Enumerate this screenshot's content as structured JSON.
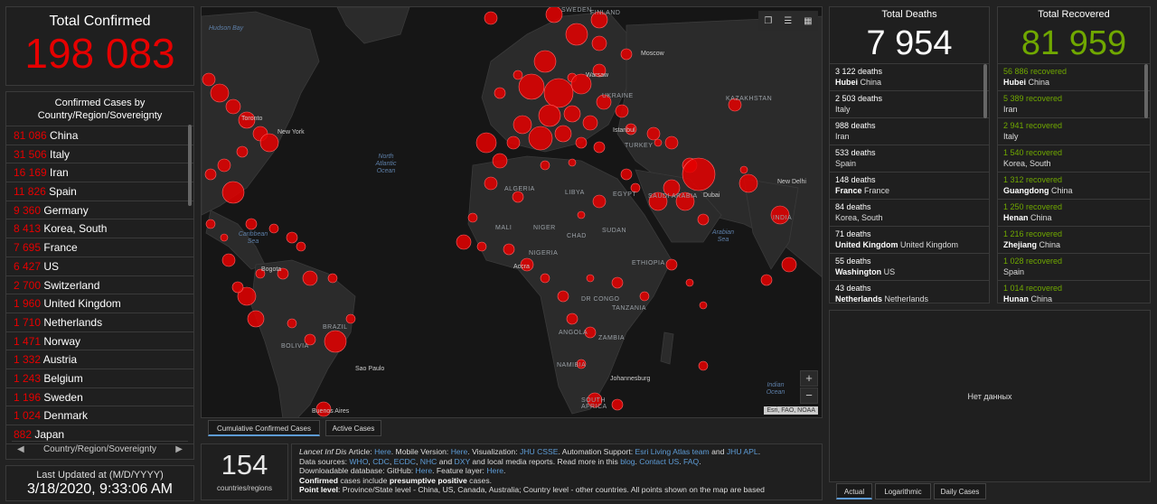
{
  "total_confirmed": {
    "title": "Total Confirmed",
    "value": "198 083"
  },
  "country_list": {
    "title": "Confirmed Cases by Country/Region/Sovereignty",
    "items": [
      {
        "count": "81 086",
        "name": "China"
      },
      {
        "count": "31 506",
        "name": "Italy"
      },
      {
        "count": "16 169",
        "name": "Iran"
      },
      {
        "count": "11 826",
        "name": "Spain"
      },
      {
        "count": "9 360",
        "name": "Germany"
      },
      {
        "count": "8 413",
        "name": "Korea, South"
      },
      {
        "count": "7 695",
        "name": "France"
      },
      {
        "count": "6 427",
        "name": "US"
      },
      {
        "count": "2 700",
        "name": "Switzerland"
      },
      {
        "count": "1 960",
        "name": "United Kingdom"
      },
      {
        "count": "1 710",
        "name": "Netherlands"
      },
      {
        "count": "1 471",
        "name": "Norway"
      },
      {
        "count": "1 332",
        "name": "Austria"
      },
      {
        "count": "1 243",
        "name": "Belgium"
      },
      {
        "count": "1 196",
        "name": "Sweden"
      },
      {
        "count": "1 024",
        "name": "Denmark"
      },
      {
        "count": "882",
        "name": "Japan"
      }
    ],
    "pager_label": "Country/Region/Sovereignty"
  },
  "last_updated": {
    "label": "Last Updated at (M/D/YYYY)",
    "value": "3/18/2020, 9:33:06 AM"
  },
  "map": {
    "country_labels": [
      "SWEDEN",
      "FINLAND",
      "UKRAINE",
      "KAZAKHSTAN",
      "TURKEY",
      "LIBYA",
      "EGYPT",
      "SAUDI ARABIA",
      "MALI",
      "NIGER",
      "CHAD",
      "SUDAN",
      "NIGERIA",
      "ETHIOPIA",
      "DR CONGO",
      "TANZANIA",
      "ANGOLA",
      "ZAMBIA",
      "NAMIBIA",
      "SOUTH AFRICA",
      "BRAZIL",
      "BOLIVIA",
      "INDIA",
      "ALGERIA"
    ],
    "ocean_labels": [
      "Hudson Bay",
      "North Atlantic Ocean",
      "Caribbean Sea",
      "Arabian Sea",
      "Indian Ocean"
    ],
    "city_labels": [
      "Moscow",
      "Warsaw",
      "Toronto",
      "New York",
      "Istanbul",
      "Dubai",
      "New Delhi",
      "Bogota",
      "Accra",
      "Sao Paulo",
      "Buenos Aires",
      "Johannesburg"
    ],
    "attribution": "Esri, FAO, NOAA",
    "tabs": [
      "Cumulative Confirmed Cases",
      "Active Cases"
    ],
    "zoom_in": "+",
    "zoom_out": "−",
    "marker_color": "#e60000"
  },
  "countries_count": {
    "value": "154",
    "label": "countries/regions"
  },
  "info": {
    "line1_prefix": "Lancet Inf Dis",
    "line1_article": " Article: ",
    "line1_here": "Here",
    "line1_mobile": ". Mobile Version: ",
    "line1_here2": "Here",
    "line1_vis": ". Visualization: ",
    "line1_jhu": "JHU CSSE",
    "line1_auto": ". Automation Support: ",
    "line1_esri": "Esri Living Atlas team",
    "line1_and": " and ",
    "line1_apl": "JHU APL",
    "line1_end": ".",
    "line2_prefix": "Data sources: ",
    "line2_who": "WHO",
    "line2_cdc": "CDC",
    "line2_ecdc": "ECDC",
    "line2_nhc": "NHC",
    "line2_and": " and ",
    "line2_dxy": "DXY",
    "line2_local": " and local media reports. Read more in this ",
    "line2_blog": "blog",
    "line2_contact": "Contact US",
    "line2_faq": "FAQ",
    "line3_prefix": "Downloadable database: GitHub: ",
    "line3_here": "Here",
    "line3_feature": ". Feature layer: ",
    "line3_here2": "Here",
    "line4_bold": "Confirmed",
    "line4_mid": " cases include ",
    "line4_bold2": "presumptive positive",
    "line4_end": " cases.",
    "line5_bold": "Point level",
    "line5_text": ": Province/State level - China, US, Canada, Australia; Country level - other countries. All points shown on the map are based"
  },
  "total_deaths": {
    "title": "Total Deaths",
    "value": "7 954",
    "items": [
      {
        "count": "3 122 deaths",
        "place_bold": "Hubei",
        "place": " China"
      },
      {
        "count": "2 503 deaths",
        "place_bold": "",
        "place": "Italy"
      },
      {
        "count": "988 deaths",
        "place_bold": "",
        "place": "Iran"
      },
      {
        "count": "533 deaths",
        "place_bold": "",
        "place": "Spain"
      },
      {
        "count": "148 deaths",
        "place_bold": "France",
        "place": " France"
      },
      {
        "count": "84 deaths",
        "place_bold": "",
        "place": "Korea, South"
      },
      {
        "count": "71 deaths",
        "place_bold": "United Kingdom",
        "place": " United Kingdom"
      },
      {
        "count": "55 deaths",
        "place_bold": "Washington",
        "place": " US"
      },
      {
        "count": "43 deaths",
        "place_bold": "Netherlands",
        "place": " Netherlands"
      }
    ]
  },
  "total_recovered": {
    "title": "Total Recovered",
    "value": "81 959",
    "items": [
      {
        "count": "56 886 recovered",
        "place_bold": "Hubei",
        "place": " China"
      },
      {
        "count": "5 389 recovered",
        "place_bold": "",
        "place": "Iran"
      },
      {
        "count": "2 941 recovered",
        "place_bold": "",
        "place": "Italy"
      },
      {
        "count": "1 540 recovered",
        "place_bold": "",
        "place": "Korea, South"
      },
      {
        "count": "1 312 recovered",
        "place_bold": "Guangdong",
        "place": " China"
      },
      {
        "count": "1 250 recovered",
        "place_bold": "Henan",
        "place": " China"
      },
      {
        "count": "1 216 recovered",
        "place_bold": "Zhejiang",
        "place": " China"
      },
      {
        "count": "1 028 recovered",
        "place_bold": "",
        "place": "Spain"
      },
      {
        "count": "1 014 recovered",
        "place_bold": "Hunan",
        "place": " China"
      }
    ]
  },
  "chart_panel": {
    "no_data": "Нет данных",
    "tabs": [
      "Actual",
      "Logarithmic",
      "Daily Cases"
    ]
  },
  "icons": {
    "bookmark": "bookmark-icon",
    "list": "list-icon",
    "grid": "grid-icon",
    "prev": "chevron-left-icon",
    "next": "chevron-right-icon"
  },
  "colors": {
    "confirmed": "#e60000",
    "recovered": "#70a800",
    "link": "#5d9bd5"
  }
}
